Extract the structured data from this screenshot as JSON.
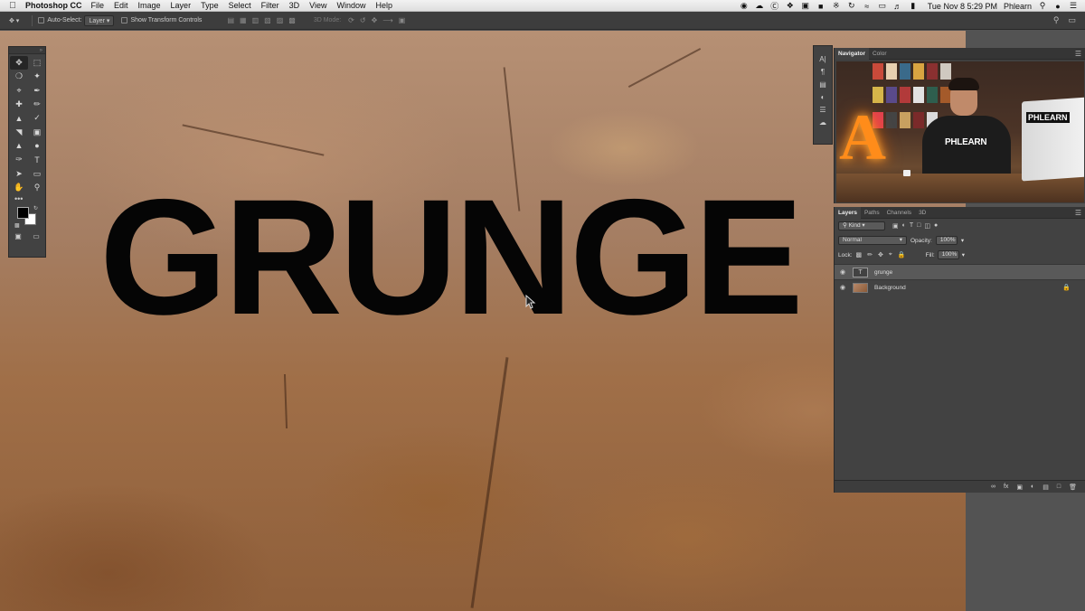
{
  "menubar": {
    "app_name": "Photoshop CC",
    "menus": [
      "File",
      "Edit",
      "Image",
      "Layer",
      "Type",
      "Select",
      "Filter",
      "3D",
      "View",
      "Window",
      "Help"
    ],
    "datetime": "Tue Nov 8  5:29 PM",
    "user": "Phlearn"
  },
  "options": {
    "auto_select_label": "Auto-Select:",
    "auto_select_value": "Layer",
    "transform_controls_label": "Show Transform Controls",
    "mode3d_label": "3D Mode:"
  },
  "canvas": {
    "text": "GRUNGE"
  },
  "navigator": {
    "tabs": [
      "Navigator",
      "Color"
    ],
    "preview": {
      "big_letter": "A",
      "shirt_text": "PHLEARN",
      "monitor_text": "PHLEARN"
    }
  },
  "layers": {
    "tabs": [
      "Layers",
      "Paths",
      "Channels",
      "3D"
    ],
    "kind_label": "Kind",
    "blend_mode": "Normal",
    "opacity_label": "Opacity:",
    "opacity_value": "100%",
    "lock_label": "Lock:",
    "fill_label": "Fill:",
    "fill_value": "100%",
    "items": [
      {
        "name": "grunge",
        "type": "text",
        "thumb": "T",
        "selected": true
      },
      {
        "name": "Background",
        "type": "image",
        "locked": true
      }
    ]
  },
  "colors": {
    "foreground": "#000000",
    "background": "#ffffff"
  }
}
